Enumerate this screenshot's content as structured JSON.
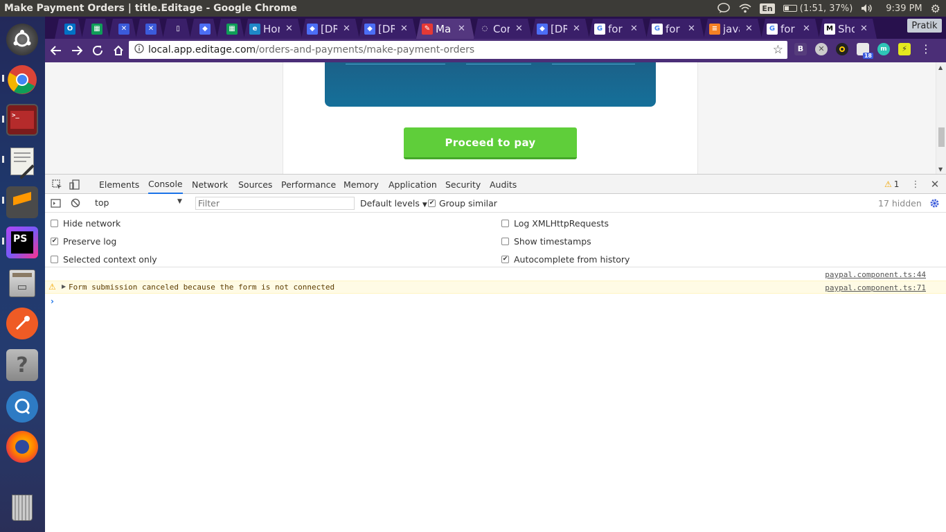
{
  "os_panel": {
    "window_title": "Make Payment Orders | title.Editage - Google Chrome",
    "keyboard_lang": "En",
    "battery_text": "(1:51, 37%)",
    "battery_level": 0.37,
    "clock": "9:39 PM"
  },
  "launcher": {
    "items": [
      "ubuntu-dash",
      "chrome",
      "terminal",
      "text-editor",
      "sublime-text",
      "phpstorm",
      "files",
      "postman",
      "help",
      "quassel",
      "firefox",
      "trash"
    ]
  },
  "browser": {
    "tabs": [
      {
        "label": "",
        "icon": "outlook-icon"
      },
      {
        "label": "",
        "icon": "sheets-icon"
      },
      {
        "label": "",
        "icon": "confluence-icon"
      },
      {
        "label": "",
        "icon": "confluence-icon"
      },
      {
        "label": "",
        "icon": "doc-icon"
      },
      {
        "label": "",
        "icon": "jira-icon"
      },
      {
        "label": "",
        "icon": "sheets-icon"
      },
      {
        "label": "Hor",
        "icon": "editage-icon"
      },
      {
        "label": "[DR",
        "icon": "jira-icon"
      },
      {
        "label": "[DR",
        "icon": "jira-icon"
      },
      {
        "label": "Ma",
        "icon": "editage-pen-icon",
        "active": true
      },
      {
        "label": "Cor",
        "icon": "loading-icon"
      },
      {
        "label": "[DR",
        "icon": "jira-icon"
      },
      {
        "label": "for",
        "icon": "google-icon"
      },
      {
        "label": "for",
        "icon": "google-icon"
      },
      {
        "label": "java",
        "icon": "stackoverflow-icon"
      },
      {
        "label": "for",
        "icon": "google-icon"
      },
      {
        "label": "Sho",
        "icon": "medium-icon"
      }
    ],
    "profile_name": "Pratik",
    "url_host": "local.app.editage.com",
    "url_path": "/orders-and-payments/make-payment-orders",
    "extension_badge": "18"
  },
  "page": {
    "proceed_label": "Proceed to pay"
  },
  "devtools": {
    "tabs": [
      "Elements",
      "Console",
      "Network",
      "Sources",
      "Performance",
      "Memory",
      "Application",
      "Security",
      "Audits"
    ],
    "active_tab": "Console",
    "warning_count": "1",
    "context": "top",
    "filter_placeholder": "Filter",
    "levels_label": "Default levels",
    "group_similar_label": "Group similar",
    "hidden_count": "17 hidden",
    "settings": [
      {
        "label": "Hide network",
        "checked": false
      },
      {
        "label": "Preserve log",
        "checked": true
      },
      {
        "label": "Selected context only",
        "checked": false
      },
      {
        "label": "Log XMLHttpRequests",
        "checked": false
      },
      {
        "label": "Show timestamps",
        "checked": false
      },
      {
        "label": "Autocomplete from history",
        "checked": true
      }
    ],
    "messages": [
      {
        "text": "",
        "source": "paypal.component.ts:44",
        "level": "info"
      },
      {
        "text": "Form submission canceled because the form is not connected",
        "source": "paypal.component.ts:71",
        "level": "warning"
      }
    ]
  },
  "colors": {
    "panel_bg": "#3c3b37",
    "tabstrip_bg": "#28114d",
    "toolbar_bg": "#4b2e77",
    "proceed_green": "#5fce3a",
    "card_blue": "#15709a",
    "warning_bg": "#fffbe5"
  }
}
